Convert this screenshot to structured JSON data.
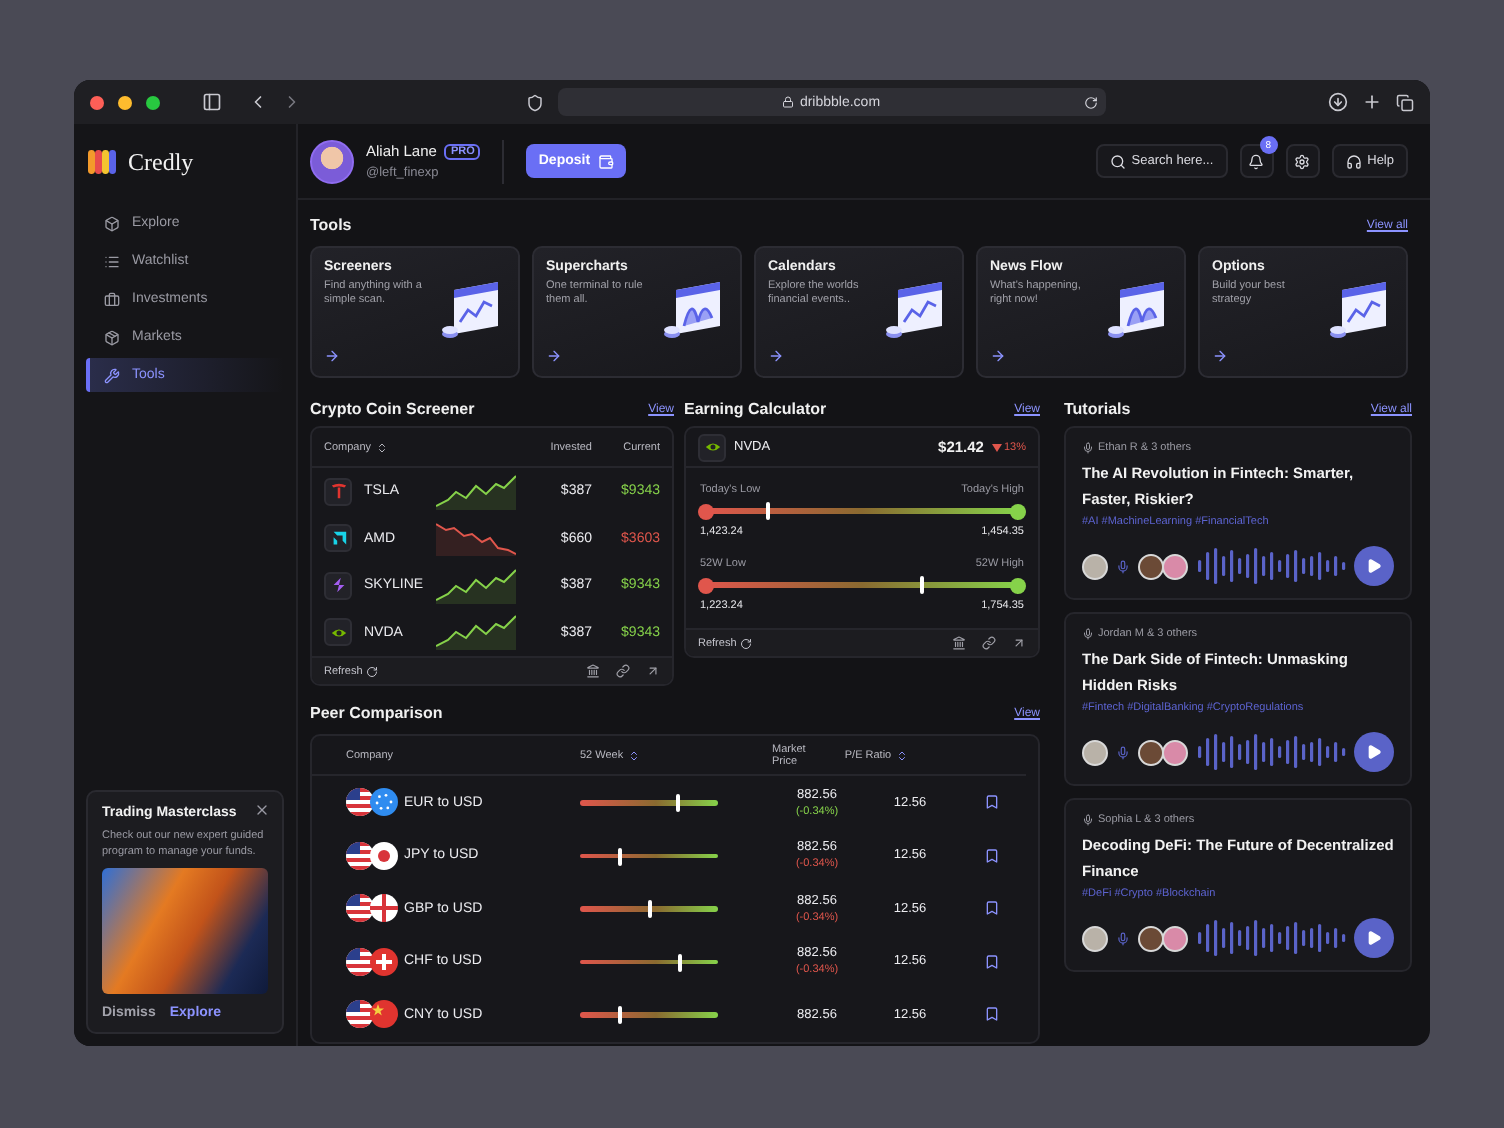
{
  "browser": {
    "url": "dribbble.com"
  },
  "brand": {
    "name": "Credly"
  },
  "user": {
    "name": "Aliah Lane",
    "badge": "PRO",
    "handle": "@left_finexp"
  },
  "header": {
    "deposit": "Deposit",
    "search": "Search here...",
    "notifications": "8",
    "help": "Help"
  },
  "sidebar": {
    "items": [
      {
        "label": "Explore",
        "selected": false
      },
      {
        "label": "Watchlist",
        "selected": false
      },
      {
        "label": "Investments",
        "selected": false
      },
      {
        "label": "Markets",
        "selected": false
      },
      {
        "label": "Tools",
        "selected": true
      }
    ]
  },
  "promo": {
    "title": "Trading Masterclass",
    "text": "Check out our new expert guided program to manage your funds.",
    "dismiss": "Dismiss",
    "explore": "Explore"
  },
  "tools": {
    "title": "Tools",
    "view_all": "View all",
    "items": [
      {
        "title": "Screeners",
        "text": "Find anything with a simple scan."
      },
      {
        "title": "Supercharts",
        "text": "One terminal to rule them all."
      },
      {
        "title": "Calendars",
        "text": "Explore the worlds financial events.."
      },
      {
        "title": "News Flow",
        "text": "What's happening, right now!"
      },
      {
        "title": "Options",
        "text": "Build your best strategy"
      }
    ]
  },
  "crypto_screener": {
    "title": "Crypto Coin Screener",
    "view": "View",
    "columns": [
      "Company",
      "Invested",
      "Current"
    ],
    "rows": [
      {
        "symbol": "TSLA",
        "invested": "$387",
        "current": "$9343",
        "color": "#86d24a"
      },
      {
        "symbol": "AMD",
        "invested": "$660",
        "current": "$3603",
        "color": "#e0564c"
      },
      {
        "symbol": "SKYLINE",
        "invested": "$387",
        "current": "$9343",
        "color": "#86d24a"
      },
      {
        "symbol": "NVDA",
        "invested": "$387",
        "current": "$9343",
        "color": "#86d24a"
      }
    ],
    "refresh": "Refresh"
  },
  "earning_calculator": {
    "title": "Earning Calculator",
    "view": "View",
    "symbol": "NVDA",
    "price": "$21.42",
    "change": "13%",
    "falling": true,
    "ranges": [
      {
        "low_label": "Today's Low",
        "high_label": "Today's High",
        "low": "1,423.24",
        "high": "1,454.35",
        "level": 0.2
      },
      {
        "low_label": "52W Low",
        "high_label": "52W High",
        "low": "1,223.24",
        "high": "1,754.35",
        "level": 0.69
      }
    ],
    "refresh": "Refresh"
  },
  "peer_comparison": {
    "title": "Peer Comparison",
    "view": "View",
    "columns": [
      "Company",
      "52 Week",
      "Market Price",
      "P/E Ratio"
    ],
    "rows": [
      {
        "pair": "EUR to USD",
        "level": 0.71,
        "price": "882.56",
        "change": "(-0.34%)",
        "color": "#86d24a",
        "pe": "12.56"
      },
      {
        "pair": "JPY to USD",
        "level": 0.29,
        "price": "882.56",
        "change": "(-0.34%)",
        "color": "#e0564c",
        "pe": "12.56"
      },
      {
        "pair": "GBP to USD",
        "level": 0.5,
        "price": "882.56",
        "change": "(-0.34%)",
        "color": "#e0564c",
        "pe": "12.56"
      },
      {
        "pair": "CHF to USD",
        "level": 0.73,
        "price": "882.56",
        "change": "(-0.34%)",
        "color": "#e0564c",
        "pe": "12.56"
      },
      {
        "pair": "CNY to USD",
        "level": 0.29,
        "price": "882.56",
        "pe": "12.56"
      }
    ]
  },
  "tutorials": {
    "title": "Tutorials",
    "view_all": "View all",
    "items": [
      {
        "authors": "Ethan R & 3 others",
        "title": "The AI Revolution in Fintech: Smarter, Faster, Riskier?",
        "tags": "#AI #MachineLearning #FinancialTech"
      },
      {
        "authors": "Jordan M & 3 others",
        "title": "The Dark Side of Fintech: Unmasking Hidden Risks",
        "tags": "#Fintech #DigitalBanking #CryptoRegulations"
      },
      {
        "authors": "Sophia L & 3 others",
        "title": "Decoding DeFi: The Future of Decentralized Finance",
        "tags": "#DeFi #Crypto #Blockchain"
      }
    ]
  }
}
